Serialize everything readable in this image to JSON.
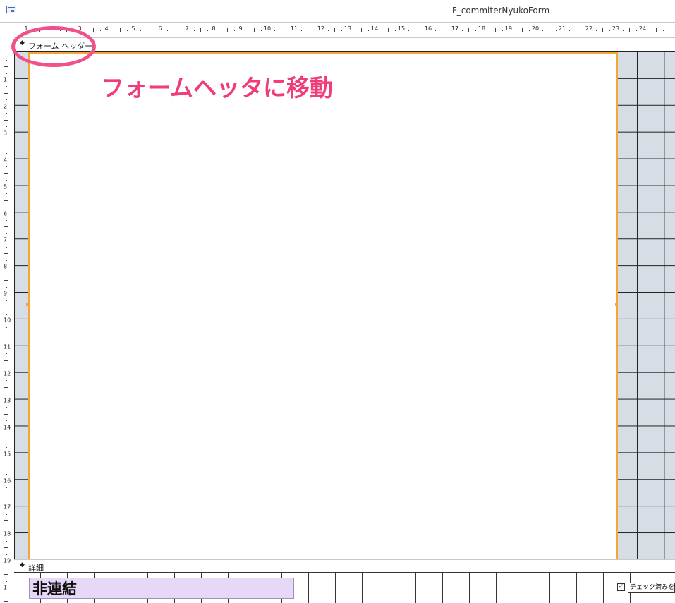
{
  "window": {
    "title": "F_commiterNyukoForm",
    "icon": "form-icon"
  },
  "ruler": {
    "horizontal_numbers": [
      "1",
      "2",
      "3",
      "4",
      "5",
      "6",
      "7",
      "8",
      "9",
      "10",
      "11",
      "12",
      "13",
      "14",
      "15",
      "16",
      "17",
      "18",
      "19",
      "20",
      "21",
      "22",
      "23",
      "24"
    ],
    "vertical_numbers": [
      "1",
      "2",
      "3",
      "4",
      "5",
      "6",
      "7",
      "8",
      "9",
      "10",
      "11",
      "12",
      "13",
      "14",
      "15",
      "16",
      "17",
      "18",
      "19",
      "1"
    ]
  },
  "sections": {
    "form_header": {
      "label": "フォーム ヘッダー",
      "icon": "section-arrow-icon"
    },
    "detail": {
      "label": "詳細",
      "icon": "section-arrow-icon"
    }
  },
  "detail": {
    "unbound_control": "非連結",
    "checkbox_label": "チェック済みを"
  },
  "annotation": {
    "text": "フォームヘッタに移動",
    "color": "#f03c7a"
  },
  "colors": {
    "selection_border": "#f6a637",
    "grid_background": "#d6dde5",
    "unbound_fill": "#e8d8f8"
  }
}
